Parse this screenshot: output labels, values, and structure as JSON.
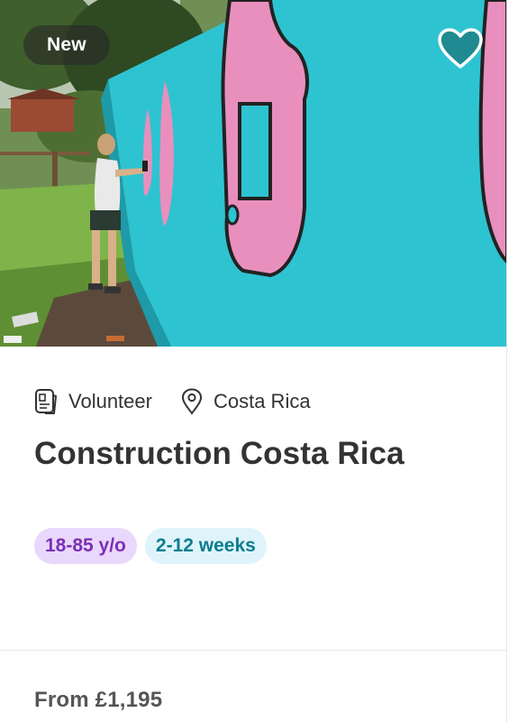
{
  "card": {
    "badge": "New",
    "meta": {
      "type_label": "Volunteer",
      "location_label": "Costa Rica"
    },
    "title": "Construction Costa Rica",
    "tags": {
      "age": "18-85 y/o",
      "duration": "2-12 weeks"
    },
    "price": "From £1,195",
    "favourite_icon": "heart-icon",
    "type_icon": "id-card-icon",
    "location_icon": "map-pin-icon"
  },
  "colors": {
    "wall_turquoise": "#2ec3d1",
    "mural_pink": "#e98fbd",
    "age_tag_bg": "#e9d8fb",
    "age_tag_text": "#7b2fb5",
    "duration_tag_bg": "#dff4fa",
    "duration_tag_text": "#0b7d8f"
  }
}
